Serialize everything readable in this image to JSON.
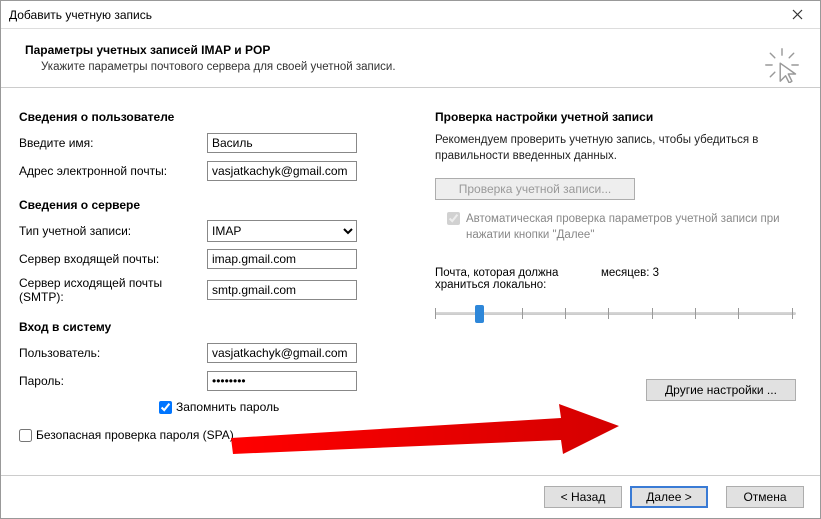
{
  "window": {
    "title": "Добавить учетную запись"
  },
  "header": {
    "title": "Параметры учетных записей IMAP и POP",
    "subtitle": "Укажите параметры почтового сервера для своей учетной записи."
  },
  "user": {
    "section": "Сведения о пользователе",
    "name_label": "Введите имя:",
    "name_value": "Василь",
    "email_label": "Адрес электронной почты:",
    "email_value": "vasjatkachyk@gmail.com"
  },
  "server": {
    "section": "Сведения о сервере",
    "type_label": "Тип учетной записи:",
    "type_value": "IMAP",
    "incoming_label": "Сервер входящей почты:",
    "incoming_value": "imap.gmail.com",
    "outgoing_label": "Сервер исходящей почты (SMTP):",
    "outgoing_value": "smtp.gmail.com"
  },
  "login": {
    "section": "Вход в систему",
    "user_label": "Пользователь:",
    "user_value": "vasjatkachyk@gmail.com",
    "pass_label": "Пароль:",
    "pass_value": "********",
    "remember": "Запомнить пароль",
    "spa": "Безопасная проверка пароля (SPA)"
  },
  "test": {
    "section": "Проверка настройки учетной записи",
    "desc": "Рекомендуем проверить учетную запись, чтобы убедиться в правильности введенных данных.",
    "button": "Проверка учетной записи...",
    "auto": "Автоматическая проверка параметров учетной записи при нажатии кнопки \"Далее\""
  },
  "storage": {
    "line1": "Почта, которая должна",
    "line2": "храниться локально:",
    "unit": "месяцев:",
    "value": "3"
  },
  "other_settings": "Другие настройки ...",
  "footer": {
    "back": "< Назад",
    "next": "Далее >",
    "cancel": "Отмена"
  }
}
